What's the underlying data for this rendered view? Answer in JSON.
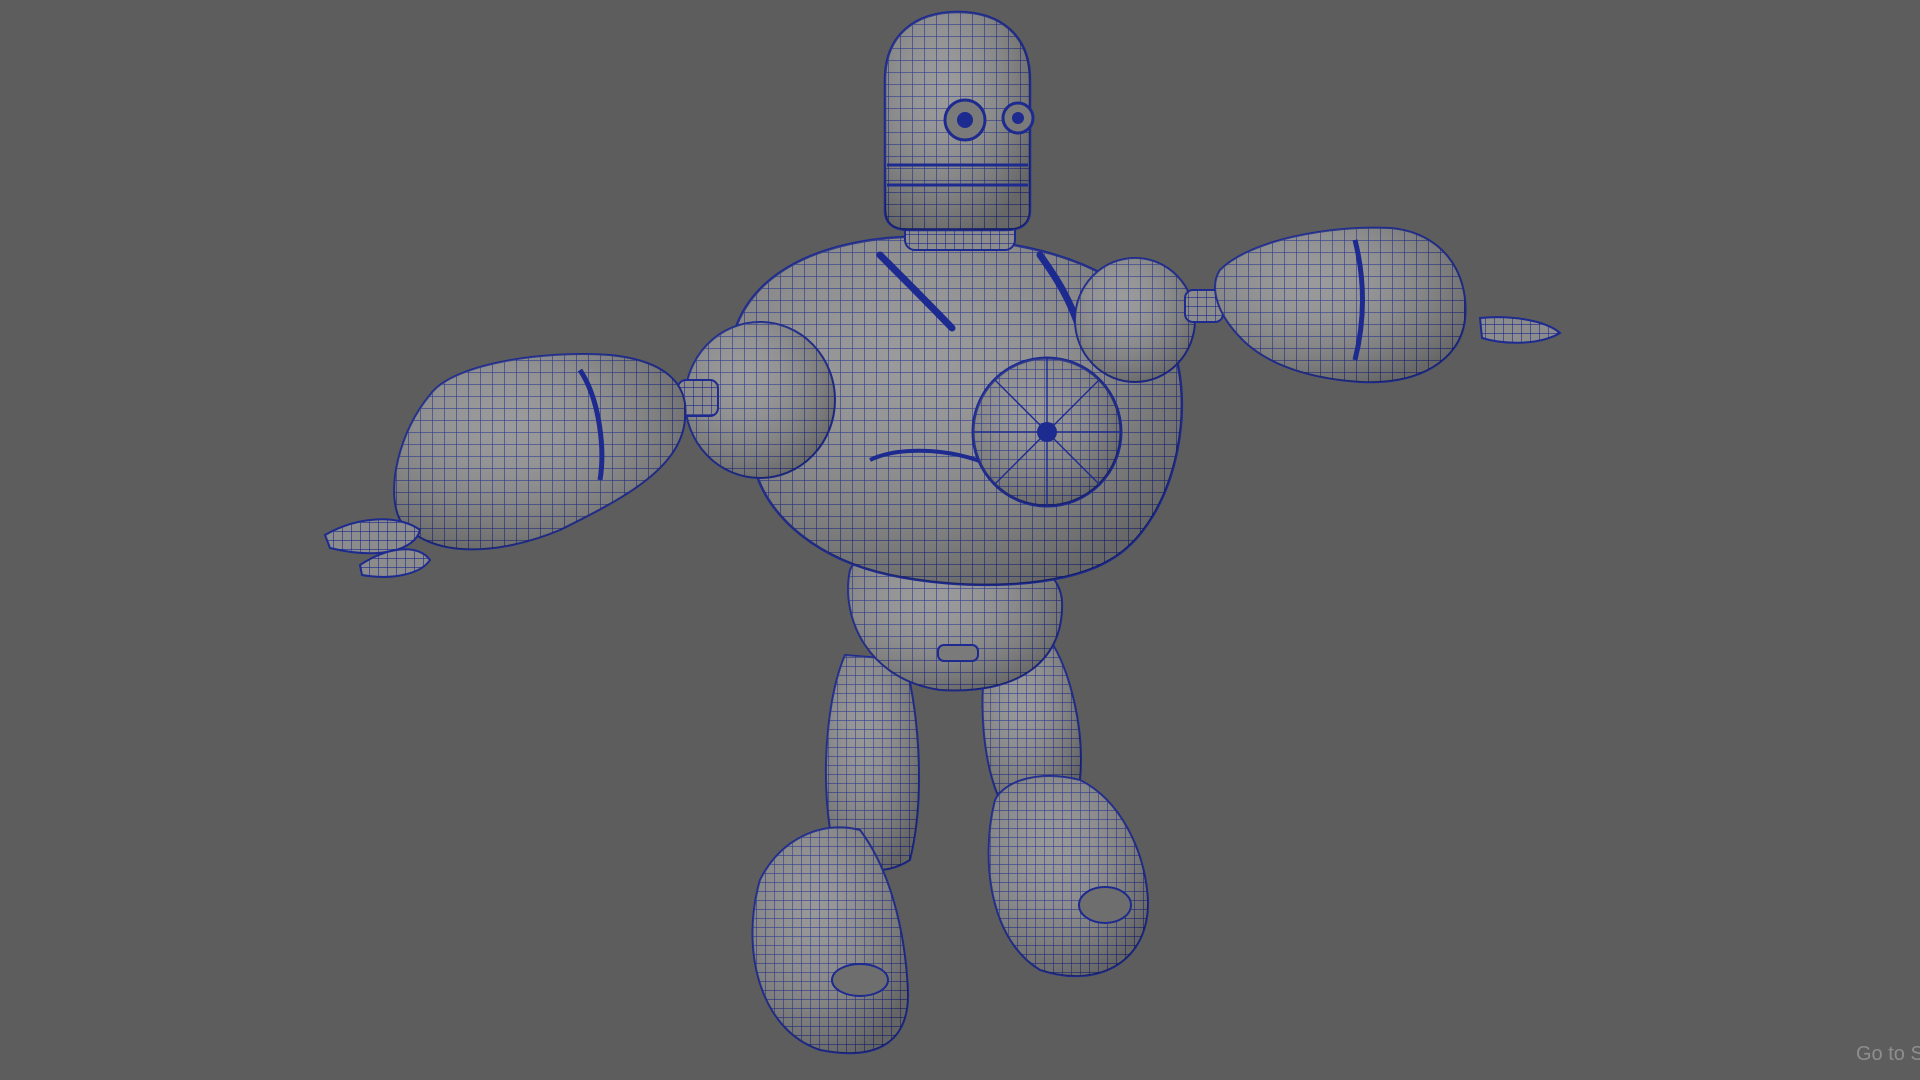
{
  "viewport": {
    "background_color": "#5d5d5d",
    "display_mode": "wireframe-on-shaded"
  },
  "model": {
    "subject": "robot-character",
    "pose": "t-pose",
    "mesh_color": "#8f8f8f",
    "wireframe_color": "#1d2a8f"
  },
  "overlay": {
    "corner_text": "Go to S"
  }
}
